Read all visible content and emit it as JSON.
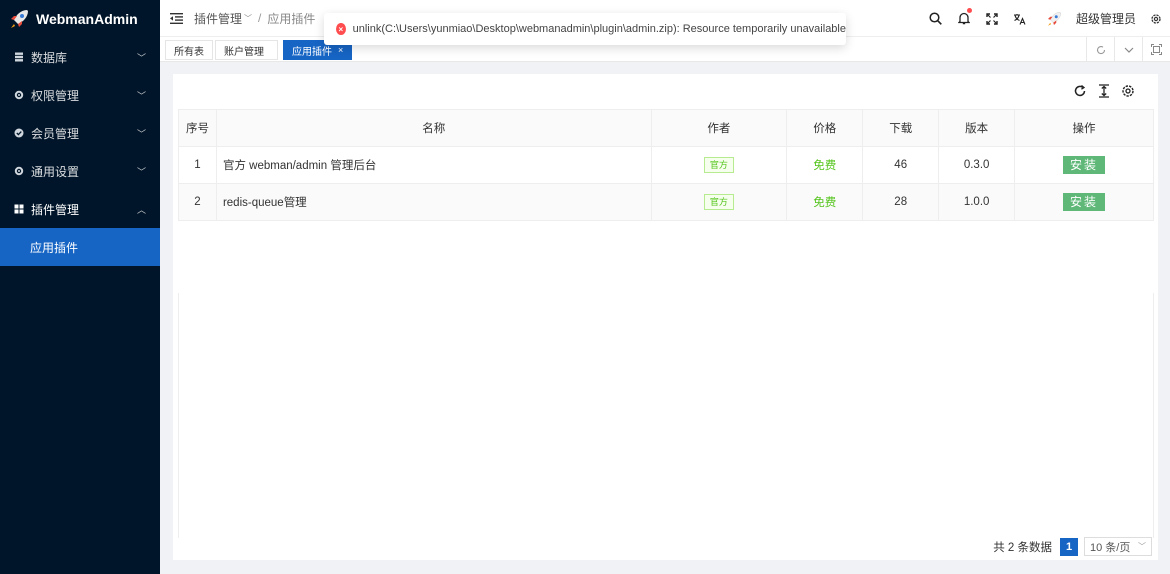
{
  "app": {
    "name": "WebmanAdmin"
  },
  "sidebar": {
    "items": [
      {
        "label": "数据库",
        "icon": "database-icon"
      },
      {
        "label": "权限管理",
        "icon": "gear-icon"
      },
      {
        "label": "会员管理",
        "icon": "check-circle-icon"
      },
      {
        "label": "通用设置",
        "icon": "gear-icon"
      },
      {
        "label": "插件管理",
        "icon": "grid-icon"
      }
    ],
    "sub_active": "应用插件"
  },
  "header": {
    "breadcrumb": [
      "插件管理",
      "应用插件"
    ],
    "user": "超级管理员"
  },
  "tabs": [
    {
      "label": "所有表"
    },
    {
      "label": "账户管理"
    },
    {
      "label": "应用插件",
      "close": "×"
    }
  ],
  "toast": {
    "message": "unlink(C:\\Users\\yunmiao\\Desktop\\webmanadmin\\plugin\\admin.zip): Resource temporarily unavailable",
    "type": "error",
    "icon": "×"
  },
  "table": {
    "columns": [
      "序号",
      "名称",
      "作者",
      "价格",
      "下载",
      "版本",
      "操作"
    ],
    "rows": [
      {
        "index": "1",
        "name": "官方 webman/admin 管理后台",
        "author": "官方",
        "price": "免费",
        "downloads": "46",
        "version": "0.3.0",
        "action": "安装"
      },
      {
        "index": "2",
        "name": "redis-queue管理",
        "author": "官方",
        "price": "免费",
        "downloads": "28",
        "version": "1.0.0",
        "action": "安装"
      }
    ]
  },
  "pager": {
    "total": "共 2 条数据",
    "page": "1",
    "size": "10 条/页"
  },
  "colors": {
    "sidebar_bg": "#001529",
    "primary": "#1664c4",
    "success": "#52c41a",
    "error": "#ff4d4f"
  }
}
